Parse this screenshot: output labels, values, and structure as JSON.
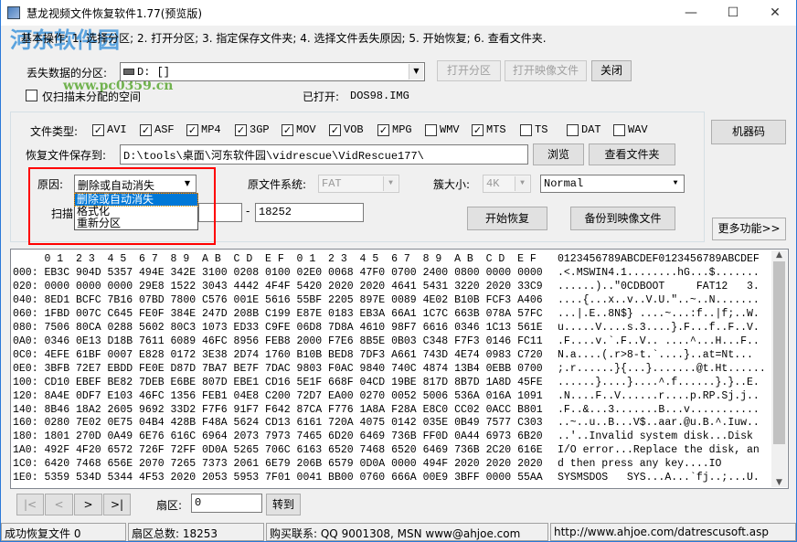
{
  "window": {
    "title": "慧龙视频文件恢复软件1.77(预览版)",
    "minimize": "—",
    "maximize": "☐",
    "close": "✕"
  },
  "watermark": {
    "name": "河东软件园",
    "url": "www.pc0359.cn"
  },
  "instructions": "基本操作: 1. 选择分区; 2. 打开分区; 3. 指定保存文件夹; 4. 选择文件丢失原因; 5. 开始恢复; 6. 查看文件夹.",
  "partition": {
    "label": "丢失数据的分区:",
    "value": "D: []",
    "open_partition": "打开分区",
    "open_image": "打开映像文件",
    "close": "关闭"
  },
  "scan_unallocated": {
    "label": "仅扫描未分配的空间",
    "checked": false
  },
  "opened": {
    "label": "已打开:",
    "value": "DOS98.IMG"
  },
  "file_types": {
    "label": "文件类型:",
    "items": [
      {
        "name": "AVI",
        "checked": true
      },
      {
        "name": "ASF",
        "checked": true
      },
      {
        "name": "MP4",
        "checked": true
      },
      {
        "name": "3GP",
        "checked": true
      },
      {
        "name": "MOV",
        "checked": true
      },
      {
        "name": "VOB",
        "checked": true
      },
      {
        "name": "MPG",
        "checked": true
      },
      {
        "name": "WMV",
        "checked": false
      },
      {
        "name": "MTS",
        "checked": true
      },
      {
        "name": "TS",
        "checked": false
      },
      {
        "name": "DAT",
        "checked": false
      },
      {
        "name": "WAV",
        "checked": false
      }
    ]
  },
  "save_to": {
    "label": "恢复文件保存到:",
    "value": "D:\\tools\\桌面\\河东软件园\\vidrescue\\VidRescue177\\",
    "browse": "浏览",
    "view_folder": "查看文件夹"
  },
  "reason": {
    "label": "原因:",
    "value": "删除或自动消失",
    "options": [
      "删除或自动消失",
      "格式化",
      "重新分区"
    ]
  },
  "fs": {
    "label": "原文件系统:",
    "value": "FAT"
  },
  "cluster": {
    "label": "簇大小:",
    "value": "4K",
    "mode": "Normal"
  },
  "scan": {
    "label": "扫描",
    "from": "",
    "dash": "-",
    "to": "18252"
  },
  "start_recovery": "开始恢复",
  "backup_image": "备份到映像文件",
  "machine_code": "机器码",
  "more_functions": "更多功能>>",
  "hex": {
    "header": "     0 1  2 3  4 5  6 7  8 9  A B  C D  E F  0 1  2 3  4 5  6 7  8 9  A B  C D  E F",
    "ascii_header": "0123456789ABCDEF0123456789ABCDEF",
    "rows": [
      {
        "line": "000: EB3C 904D 5357 494E 342E 3100 0208 0100 02E0 0068 47F0 0700 2400 0800 0000 0000",
        "ascii": ".<.MSWIN4.1........hG...$......."
      },
      {
        "line": "020: 0000 0000 0000 29E8 1522 3043 4442 4F4F 5420 2020 2020 4641 5431 3220 2020 33C9",
        "ascii": "......)..\"0CDBOOT     FAT12   3."
      },
      {
        "line": "040: 8ED1 BCFC 7B16 07BD 7800 C576 001E 5616 55BF 2205 897E 0089 4E02 B10B FCF3 A406",
        "ascii": "....{...x..v..V.U.\"..~..N......."
      },
      {
        "line": "060: 1FBD 007C C645 FE0F 384E 247D 208B C199 E87E 0183 EB3A 66A1 1C7C 663B 078A 57FC",
        "ascii": "...|.E..8N$} ....~...:f..|f;..W."
      },
      {
        "line": "080: 7506 80CA 0288 5602 80C3 1073 ED33 C9FE 06D8 7D8A 4610 98F7 6616 0346 1C13 561E",
        "ascii": "u.....V....s.3....}.F...f..F..V."
      },
      {
        "line": "0A0: 0346 0E13 D18B 7611 6089 46FC 8956 FEB8 2000 F7E6 8B5E 0B03 C348 F7F3 0146 FC11",
        "ascii": ".F....v.`.F..V.. ....^...H...F.."
      },
      {
        "line": "0C0: 4EFE 61BF 0007 E828 0172 3E38 2D74 1760 B10B BED8 7DF3 A661 743D 4E74 0983 C720",
        "ascii": "N.a....(.r>8-t.`....}..at=Nt... "
      },
      {
        "line": "0E0: 3BFB 72E7 EBDD FE0E D87D 7BA7 BE7F 7DAC 9803 F0AC 9840 740C 4874 13B4 0EBB 0700",
        "ascii": ";.r......}{...}.......@t.Ht......"
      },
      {
        "line": "100: CD10 EBEF BE82 7DEB E6BE 807D EBE1 CD16 5E1F 668F 04CD 19BE 817D 8B7D 1A8D 45FE",
        "ascii": "......}....}....^.f......}.}..E."
      },
      {
        "line": "120: 8A4E 0DF7 E103 46FC 1356 FEB1 04E8 C200 72D7 EA00 0270 0052 5006 536A 016A 1091",
        "ascii": ".N....F..V......r....p.RP.Sj.j.."
      },
      {
        "line": "140: 8B46 18A2 2605 9692 33D2 F7F6 91F7 F642 87CA F776 1A8A F28A E8C0 CC02 0ACC B801",
        "ascii": ".F..&...3.......B...v..........."
      },
      {
        "line": "160: 0280 7E02 0E75 04B4 428B F48A 5624 CD13 6161 720A 4075 0142 035E 0B49 7577 C303",
        "ascii": "..~..u..B...V$..aar.@u.B.^.Iuw.."
      },
      {
        "line": "180: 1801 270D 0A49 6E76 616C 6964 2073 7973 7465 6D20 6469 736B FF0D 0A44 6973 6B20",
        "ascii": "..'..Invalid system disk...Disk "
      },
      {
        "line": "1A0: 492F 4F20 6572 726F 72FF 0D0A 5265 706C 6163 6520 7468 6520 6469 736B 2C20 616E",
        "ascii": "I/O error...Replace the disk, an"
      },
      {
        "line": "1C0: 6420 7468 656E 2070 7265 7373 2061 6E79 206B 6579 0D0A 0000 494F 2020 2020 2020",
        "ascii": "d then press any key....IO      "
      },
      {
        "line": "1E0: 5359 534D 5344 4F53 2020 2053 5953 7F01 0041 BB00 0760 666A 00E9 3BFF 0000 55AA",
        "ascii": "SYSMSDOS   SYS...A...`fj..;...U."
      }
    ]
  },
  "nav": {
    "first": "|<",
    "prev": "<",
    "next": ">",
    "last": ">|",
    "sector_label": "扇区:",
    "sector_value": "0",
    "goto": "转到"
  },
  "statusbar": {
    "recovered": "成功恢复文件 0",
    "total_sectors": "扇区总数: 18253",
    "contact": "购买联系: QQ 9001308, MSN www@ahjoe.com",
    "url": "http://www.ahjoe.com/datrescusoft.asp"
  },
  "colors": {
    "highlight": "#0078d7",
    "annotation": "#ff0000",
    "window_border": "#2b79d8"
  }
}
